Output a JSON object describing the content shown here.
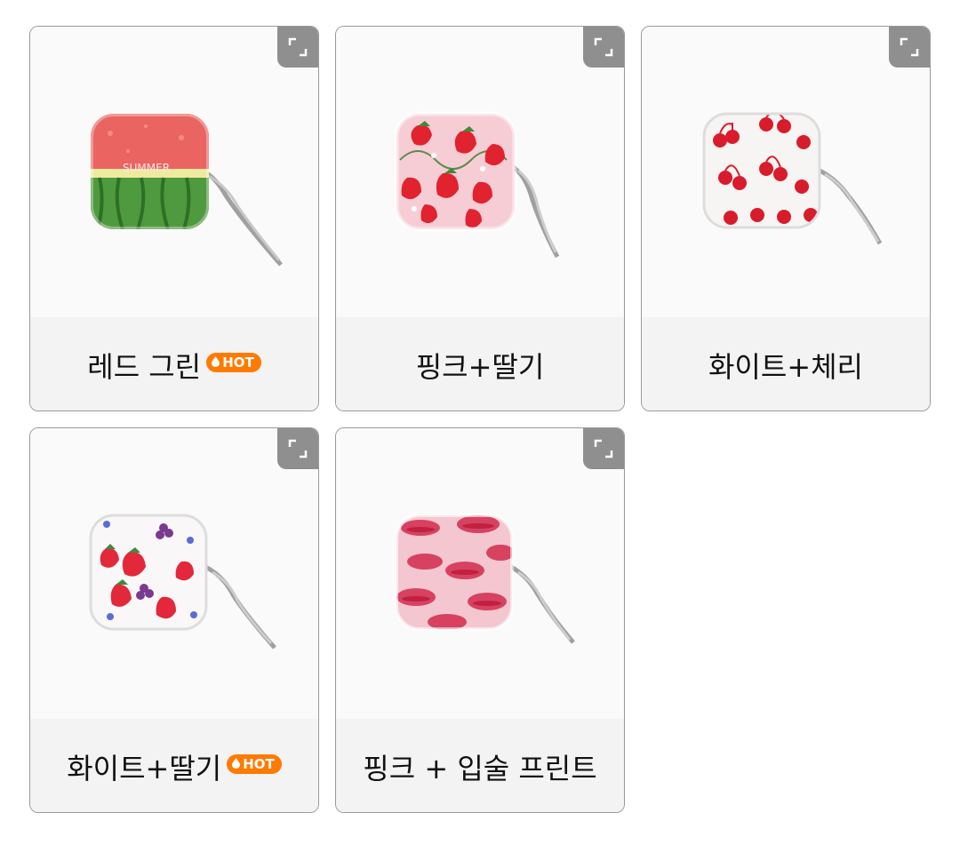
{
  "products": [
    {
      "label": "레드 그린",
      "hot": true,
      "design": "watermelon"
    },
    {
      "label": "핑크+딸기",
      "hot": false,
      "design": "pink-strawberry"
    },
    {
      "label": "화이트+체리",
      "hot": false,
      "design": "white-cherry"
    },
    {
      "label": "화이트+딸기",
      "hot": true,
      "design": "white-strawberry"
    },
    {
      "label": "핑크 + 입술 프린트",
      "hot": false,
      "design": "pink-lips"
    }
  ],
  "badges": {
    "hot_label": "HOT"
  },
  "watermelon_print": "SUMMER",
  "colors": {
    "hot_badge": "#ff7a00",
    "expand_button": "#8f8f8f",
    "card_border": "#9a9a9a"
  }
}
